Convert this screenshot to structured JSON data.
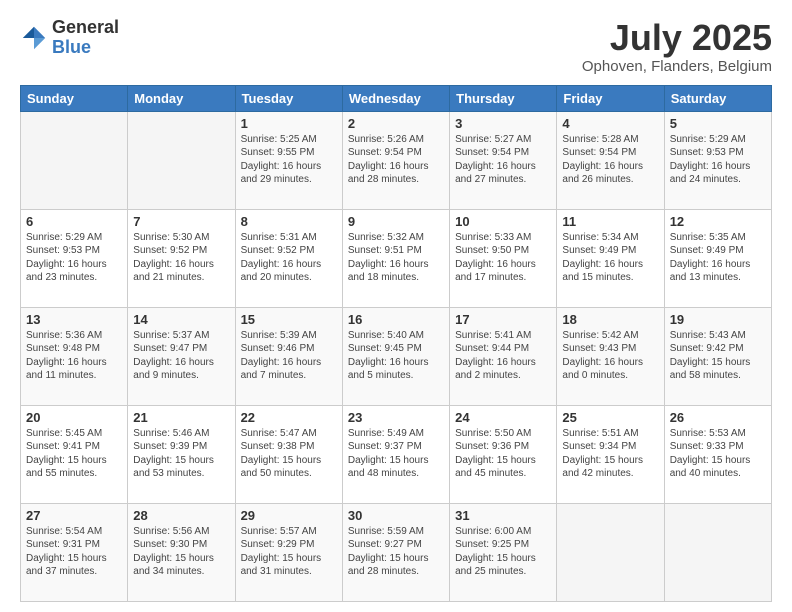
{
  "header": {
    "logo_general": "General",
    "logo_blue": "Blue",
    "month_year": "July 2025",
    "location": "Ophoven, Flanders, Belgium"
  },
  "calendar": {
    "headers": [
      "Sunday",
      "Monday",
      "Tuesday",
      "Wednesday",
      "Thursday",
      "Friday",
      "Saturday"
    ],
    "weeks": [
      [
        {
          "day": "",
          "info": ""
        },
        {
          "day": "",
          "info": ""
        },
        {
          "day": "1",
          "info": "Sunrise: 5:25 AM\nSunset: 9:55 PM\nDaylight: 16 hours\nand 29 minutes."
        },
        {
          "day": "2",
          "info": "Sunrise: 5:26 AM\nSunset: 9:54 PM\nDaylight: 16 hours\nand 28 minutes."
        },
        {
          "day": "3",
          "info": "Sunrise: 5:27 AM\nSunset: 9:54 PM\nDaylight: 16 hours\nand 27 minutes."
        },
        {
          "day": "4",
          "info": "Sunrise: 5:28 AM\nSunset: 9:54 PM\nDaylight: 16 hours\nand 26 minutes."
        },
        {
          "day": "5",
          "info": "Sunrise: 5:29 AM\nSunset: 9:53 PM\nDaylight: 16 hours\nand 24 minutes."
        }
      ],
      [
        {
          "day": "6",
          "info": "Sunrise: 5:29 AM\nSunset: 9:53 PM\nDaylight: 16 hours\nand 23 minutes."
        },
        {
          "day": "7",
          "info": "Sunrise: 5:30 AM\nSunset: 9:52 PM\nDaylight: 16 hours\nand 21 minutes."
        },
        {
          "day": "8",
          "info": "Sunrise: 5:31 AM\nSunset: 9:52 PM\nDaylight: 16 hours\nand 20 minutes."
        },
        {
          "day": "9",
          "info": "Sunrise: 5:32 AM\nSunset: 9:51 PM\nDaylight: 16 hours\nand 18 minutes."
        },
        {
          "day": "10",
          "info": "Sunrise: 5:33 AM\nSunset: 9:50 PM\nDaylight: 16 hours\nand 17 minutes."
        },
        {
          "day": "11",
          "info": "Sunrise: 5:34 AM\nSunset: 9:49 PM\nDaylight: 16 hours\nand 15 minutes."
        },
        {
          "day": "12",
          "info": "Sunrise: 5:35 AM\nSunset: 9:49 PM\nDaylight: 16 hours\nand 13 minutes."
        }
      ],
      [
        {
          "day": "13",
          "info": "Sunrise: 5:36 AM\nSunset: 9:48 PM\nDaylight: 16 hours\nand 11 minutes."
        },
        {
          "day": "14",
          "info": "Sunrise: 5:37 AM\nSunset: 9:47 PM\nDaylight: 16 hours\nand 9 minutes."
        },
        {
          "day": "15",
          "info": "Sunrise: 5:39 AM\nSunset: 9:46 PM\nDaylight: 16 hours\nand 7 minutes."
        },
        {
          "day": "16",
          "info": "Sunrise: 5:40 AM\nSunset: 9:45 PM\nDaylight: 16 hours\nand 5 minutes."
        },
        {
          "day": "17",
          "info": "Sunrise: 5:41 AM\nSunset: 9:44 PM\nDaylight: 16 hours\nand 2 minutes."
        },
        {
          "day": "18",
          "info": "Sunrise: 5:42 AM\nSunset: 9:43 PM\nDaylight: 16 hours\nand 0 minutes."
        },
        {
          "day": "19",
          "info": "Sunrise: 5:43 AM\nSunset: 9:42 PM\nDaylight: 15 hours\nand 58 minutes."
        }
      ],
      [
        {
          "day": "20",
          "info": "Sunrise: 5:45 AM\nSunset: 9:41 PM\nDaylight: 15 hours\nand 55 minutes."
        },
        {
          "day": "21",
          "info": "Sunrise: 5:46 AM\nSunset: 9:39 PM\nDaylight: 15 hours\nand 53 minutes."
        },
        {
          "day": "22",
          "info": "Sunrise: 5:47 AM\nSunset: 9:38 PM\nDaylight: 15 hours\nand 50 minutes."
        },
        {
          "day": "23",
          "info": "Sunrise: 5:49 AM\nSunset: 9:37 PM\nDaylight: 15 hours\nand 48 minutes."
        },
        {
          "day": "24",
          "info": "Sunrise: 5:50 AM\nSunset: 9:36 PM\nDaylight: 15 hours\nand 45 minutes."
        },
        {
          "day": "25",
          "info": "Sunrise: 5:51 AM\nSunset: 9:34 PM\nDaylight: 15 hours\nand 42 minutes."
        },
        {
          "day": "26",
          "info": "Sunrise: 5:53 AM\nSunset: 9:33 PM\nDaylight: 15 hours\nand 40 minutes."
        }
      ],
      [
        {
          "day": "27",
          "info": "Sunrise: 5:54 AM\nSunset: 9:31 PM\nDaylight: 15 hours\nand 37 minutes."
        },
        {
          "day": "28",
          "info": "Sunrise: 5:56 AM\nSunset: 9:30 PM\nDaylight: 15 hours\nand 34 minutes."
        },
        {
          "day": "29",
          "info": "Sunrise: 5:57 AM\nSunset: 9:29 PM\nDaylight: 15 hours\nand 31 minutes."
        },
        {
          "day": "30",
          "info": "Sunrise: 5:59 AM\nSunset: 9:27 PM\nDaylight: 15 hours\nand 28 minutes."
        },
        {
          "day": "31",
          "info": "Sunrise: 6:00 AM\nSunset: 9:25 PM\nDaylight: 15 hours\nand 25 minutes."
        },
        {
          "day": "",
          "info": ""
        },
        {
          "day": "",
          "info": ""
        }
      ]
    ]
  }
}
